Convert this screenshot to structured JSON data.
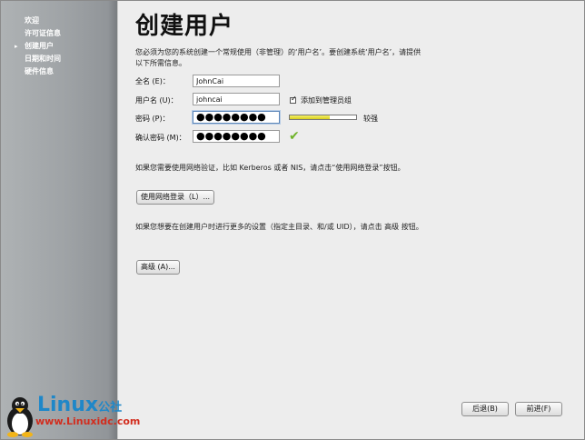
{
  "sidebar": {
    "items": [
      {
        "label": "欢迎",
        "current": false
      },
      {
        "label": "许可证信息",
        "current": false
      },
      {
        "label": "创建用户",
        "current": true
      },
      {
        "label": "日期和时间",
        "current": false
      },
      {
        "label": "硬件信息",
        "current": false
      }
    ],
    "current_marker": "▸"
  },
  "page": {
    "title": "创建用户",
    "intro": "您必须为您的系统创建一个常规使用（非管理）的‘用户名’。要创建系统‘用户名’，请提供以下所需信息。"
  },
  "form": {
    "full_name_label": "全名 (E)：",
    "full_name_value": "JohnCai",
    "username_label": "用户名 (U)：",
    "username_value": "johncai",
    "password_label": "密码 (P)：",
    "password_value": "●●●●●●●●",
    "confirm_label": "确认密码 (M)：",
    "confirm_value": "●●●●●●●●",
    "admin_label": "添加到管理员组",
    "admin_checked": true,
    "strength_label": "较强",
    "strength_level": 0.6,
    "strength_color": "#e6dc2a",
    "match_icon": "✔",
    "match_color": "#6fb32a"
  },
  "network": {
    "info": "如果您需要使用网络验证，比如 Kerberos 或者 NIS，请点击“使用网络登录”按钮。",
    "button": "使用网络登录（L）..."
  },
  "advanced": {
    "info": "如果您想要在创建用户时进行更多的设置（指定主目录、和/或 UID），请点击 高级 按钮。",
    "button": "高级 (A)..."
  },
  "footer": {
    "back": "后退(B)",
    "next": "前进(F)"
  },
  "watermark": {
    "brand": "Linux",
    "brand_cn": "公社",
    "url": "www.Linuxidc.com"
  }
}
